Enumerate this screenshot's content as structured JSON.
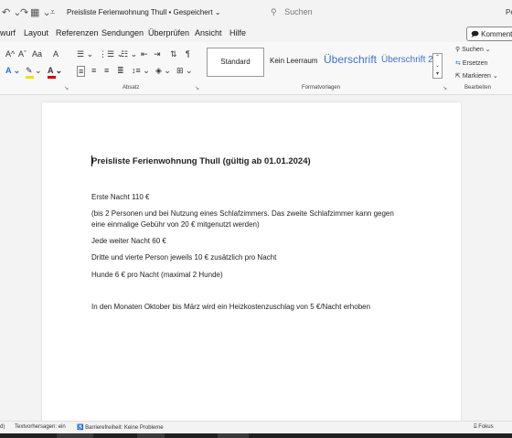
{
  "titlebar": {
    "document_title": "Preisliste Ferienwohnung Thull • Gespeichert ⌄",
    "search_placeholder": "Suchen",
    "right_text": "Pe"
  },
  "menu": {
    "items": [
      "wurf",
      "Layout",
      "Referenzen",
      "Sendungen",
      "Überprüfen",
      "Ansicht",
      "Hilfe"
    ],
    "comment_button": "Kommentare"
  },
  "ribbon": {
    "groups": {
      "paragraph": "Absatz",
      "styles": "Formatvorlagen",
      "editing": "Bearbeiten"
    },
    "styles": [
      "Standard",
      "Kein Leerraum",
      "Überschrift",
      "Überschrift 2"
    ],
    "editing": {
      "search": "Suchen",
      "replace": "Ersetzen",
      "select": "Markieren"
    },
    "font_buttons": {
      "grow": "A^",
      "shrink": "Aˇ",
      "case": "Aa",
      "clear": "A"
    },
    "colors": {
      "highlight": "#f5e000",
      "font_color": "#d00000",
      "effects_blue": "#2f6fd6",
      "heading": "#4472c4"
    }
  },
  "document": {
    "title": "Preisliste Ferienwohnung Thull (gültig ab 01.01.2024)",
    "lines": [
      "Erste Nacht     110 €",
      "(bis 2 Personen und bei Nutzung eines Schlafzimmers. Das zweite Schlafzimmer kann gegen",
      "eine einmalige Gebühr von 20 € mitgenutzt werden)",
      "Jede weiter Nacht      60 €",
      "Dritte und vierte Person jeweils 10 € zusätzlich pro Nacht",
      "Hunde 6 € pro Nacht (maximal 2 Hunde)",
      "In den Monaten Oktober bis März wird ein Heizkostenzuschlag von 5 €/Nacht erhoben"
    ]
  },
  "statusbar": {
    "left_fragment": "d)",
    "text_predictions": "Textvorhersagen: ein",
    "accessibility": "Barrierefreiheit: Keine Probleme",
    "focus": "Fokus"
  }
}
